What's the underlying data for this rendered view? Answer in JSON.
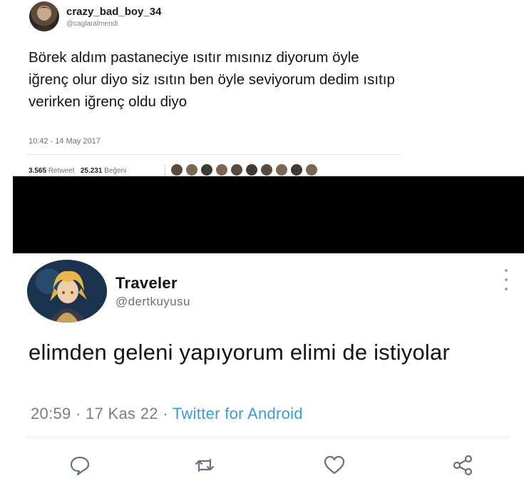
{
  "top_tweet": {
    "display_name": "crazy_bad_boy_34",
    "handle": "@caglaralmendi",
    "text": "Börek aldım pastaneciye ısıtır mısınız diyorum öyle iğrenç olur diyo siz ısıtın ben öyle seviyorum dedim ısıtıp verirken iğrenç oldu diyo",
    "timestamp": "10:42 - 14 May 2017",
    "retweet_count": "3.565",
    "retweet_label": "Retweet",
    "like_count": "25.231",
    "like_label": "Beğeni",
    "liker_avatars": 10
  },
  "bottom_tweet": {
    "display_name": "Traveler",
    "handle": "@dertkuyusu",
    "text": "elimden geleni yapıyorum elimi de istiyolar",
    "time": "20:59",
    "date": "17 Kas 22",
    "separator": "·",
    "source": "Twitter for Android",
    "actions": [
      "reply-icon",
      "retweet-icon",
      "like-icon",
      "share-icon"
    ],
    "accent_color": "#3a9bd6"
  }
}
